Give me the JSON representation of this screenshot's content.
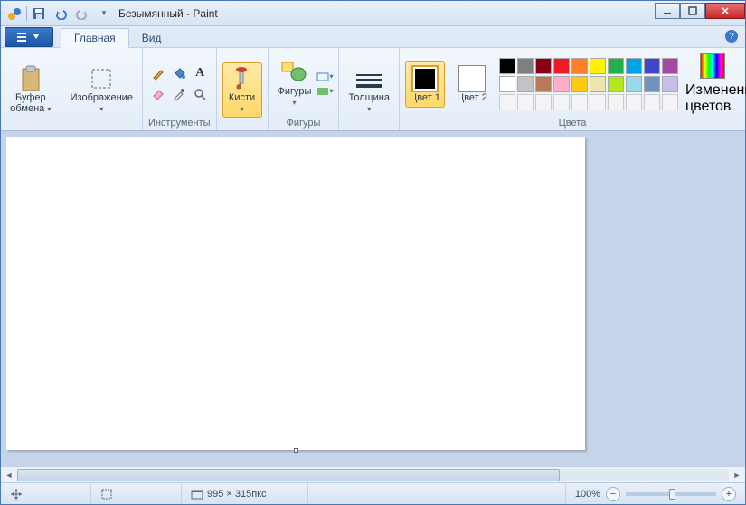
{
  "window": {
    "title": "Безымянный - Paint"
  },
  "tabs": {
    "main": "Главная",
    "view": "Вид"
  },
  "groups": {
    "clipboard": "Буфер обмена",
    "image": "Изображение",
    "tools": "Инструменты",
    "brushes": "Кисти",
    "shapes": "Фигуры",
    "size": "Толщина",
    "color1": "Цвет 1",
    "color2": "Цвет 2",
    "colors": "Цвета",
    "edit_colors": "Изменение цветов"
  },
  "palette_row1": [
    "#000000",
    "#7f7f7f",
    "#880015",
    "#ed1c24",
    "#ff7f27",
    "#fff200",
    "#22b14c",
    "#00a2e8",
    "#3f48cc",
    "#a349a4"
  ],
  "palette_row2": [
    "#ffffff",
    "#c3c3c3",
    "#b97a57",
    "#ffaec9",
    "#ffc90e",
    "#efe4b0",
    "#b5e61d",
    "#99d9ea",
    "#7092be",
    "#c8bfe7"
  ],
  "status": {
    "canvas_size": "995 × 315пкс",
    "zoom": "100%"
  }
}
